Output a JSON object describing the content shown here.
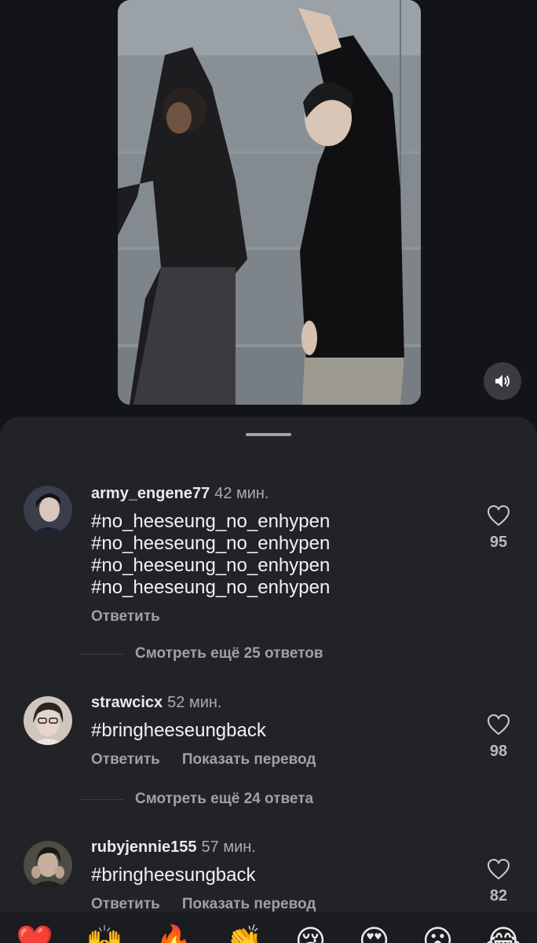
{
  "video": {
    "mute_icon": "speaker-icon"
  },
  "comments": [
    {
      "username": "army_engene77",
      "time": "42 мин.",
      "text": "#no_heeseung_no_enhypen\n#no_heeseung_no_enhypen\n#no_heeseung_no_enhypen\n#no_heeseung_no_enhypen",
      "reply_label": "Ответить",
      "likes": "95",
      "more_replies": "Смотреть ещё 25 ответов"
    },
    {
      "username": "strawcicx",
      "time": "52 мин.",
      "text": "#bringheeseungback",
      "reply_label": "Ответить",
      "translate_label": "Показать перевод",
      "likes": "98",
      "more_replies": "Смотреть ещё 24 ответа"
    },
    {
      "username": "rubyjennie155",
      "time": "57 мин.",
      "text": "#bringheesungback",
      "reply_label": "Ответить",
      "translate_label": "Показать перевод",
      "likes": "82"
    }
  ],
  "emoji_bar": [
    "❤️",
    "🙌",
    "🔥",
    "👏",
    "😢",
    "😍",
    "😮",
    "😂"
  ],
  "colors": {
    "background": "#121418",
    "sheet": "#222326",
    "muted_text": "#9fa1a5"
  }
}
